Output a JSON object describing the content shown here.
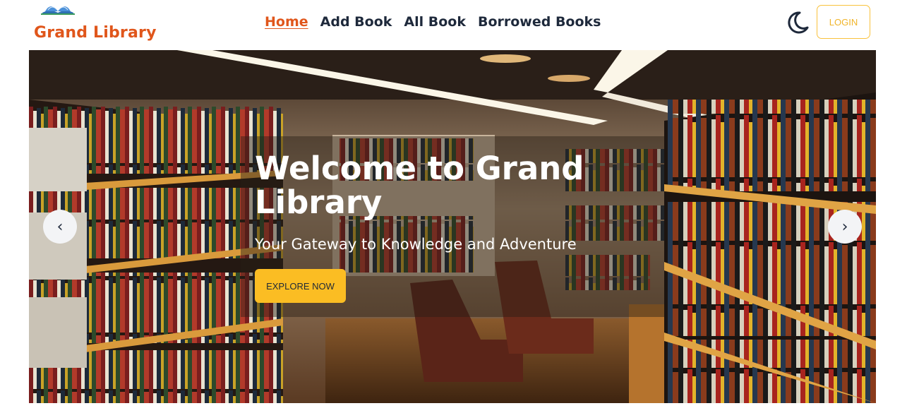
{
  "brand": {
    "name": "Grand Library",
    "logo_icon": "open-book-icon"
  },
  "nav": {
    "items": [
      {
        "label": "Home",
        "active": true
      },
      {
        "label": "Add Book",
        "active": false
      },
      {
        "label": "All Book",
        "active": false
      },
      {
        "label": "Borrowed Books",
        "active": false
      }
    ]
  },
  "header": {
    "theme_icon": "moon-icon",
    "login_label": "LOGIN"
  },
  "hero": {
    "title": "Welcome to Grand Library",
    "subtitle": "Your Gateway to Knowledge and Adventure",
    "cta_label": "EXPLORE NOW",
    "prev_glyph": "‹",
    "next_glyph": "›",
    "image_icon": "library-bookshelves-image"
  },
  "colors": {
    "accent": "#e0561b",
    "cta": "#fbbd23",
    "login_border": "#f9c23c",
    "text_dark": "#1e293b"
  }
}
